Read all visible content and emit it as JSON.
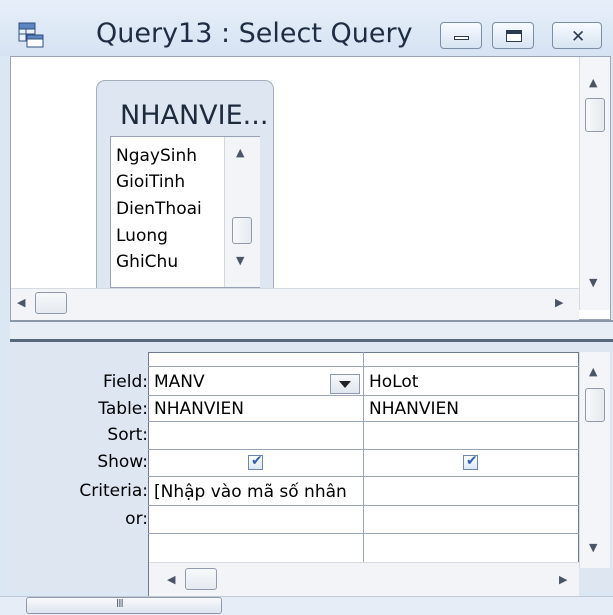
{
  "window": {
    "title": "Query13 : Select Query",
    "controls": {
      "minimize_icon": "minimize-icon",
      "maximize_icon": "maximize-icon",
      "close_icon": "close-icon",
      "close_glyph": "✕"
    }
  },
  "table_box": {
    "title": "NHANVIE...",
    "fields": [
      "NgaySinh",
      "GioiTinh",
      "DienThoai",
      "Luong",
      "GhiChu"
    ]
  },
  "grid": {
    "row_labels": [
      "Field:",
      "Table:",
      "Sort:",
      "Show:",
      "Criteria:",
      "or:"
    ],
    "columns": [
      {
        "field": "MANV",
        "table": "NHANVIEN",
        "sort": "",
        "show": true,
        "criteria": "[Nhập vào mã số nhân",
        "or": ""
      },
      {
        "field": "HoLot",
        "table": "NHANVIEN",
        "sort": "",
        "show": true,
        "criteria": "",
        "or": ""
      }
    ]
  },
  "scrollbars": {
    "grip_glyph": "III"
  },
  "colors": {
    "accent": "#2f61b3",
    "window_bg": "#dce7f4",
    "border": "#9aa6b5"
  }
}
